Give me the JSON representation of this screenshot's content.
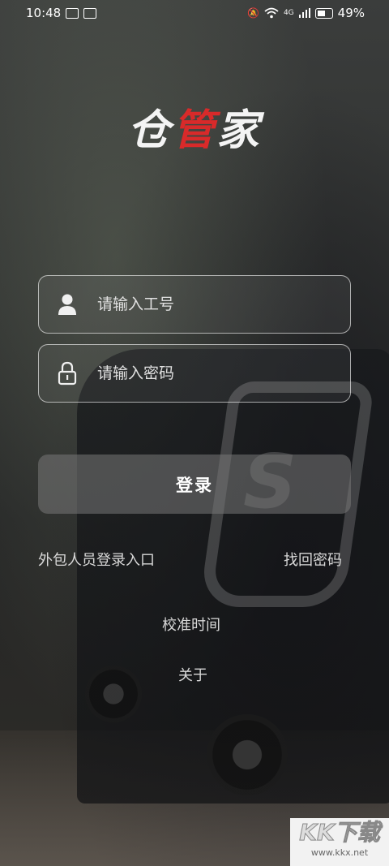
{
  "status_bar": {
    "time": "10:48",
    "network_label": "4G",
    "battery": "49%"
  },
  "app": {
    "logo_part1": "仓",
    "logo_part2": "管",
    "logo_part3": "家"
  },
  "form": {
    "employee_id_placeholder": "请输入工号",
    "employee_id_value": "",
    "password_placeholder": "请输入密码",
    "password_value": ""
  },
  "actions": {
    "login_label": "登录",
    "outsourced_login_label": "外包人员登录入口",
    "recover_password_label": "找回密码",
    "calibrate_time_label": "校准时间",
    "about_label": "关于"
  },
  "watermark": {
    "main": "KK下载",
    "sub": "www.kkx.net"
  },
  "colors": {
    "accent_red": "#d82a2a",
    "button_bg": "#787878"
  }
}
